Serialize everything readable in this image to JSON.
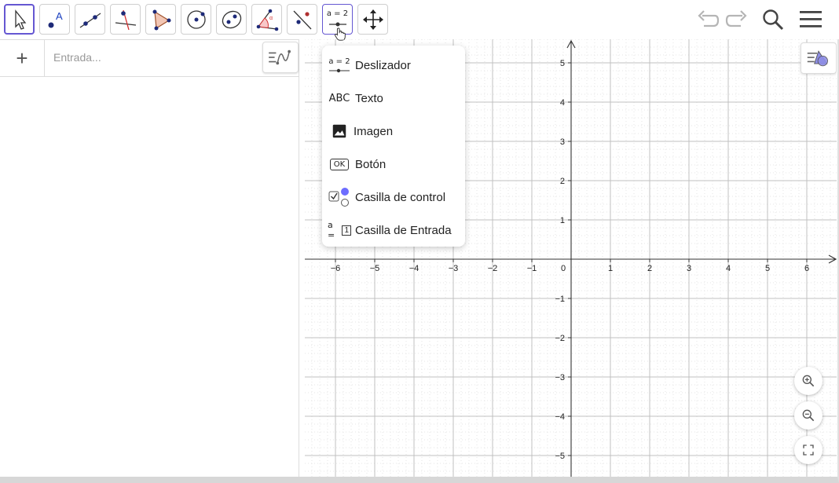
{
  "toolbar": {
    "tools": [
      {
        "name": "move-tool",
        "icon": "cursor-arrow-icon",
        "active": true
      },
      {
        "name": "point-tool",
        "icon": "point-icon"
      },
      {
        "name": "line-tool",
        "icon": "line-icon"
      },
      {
        "name": "perpendicular-line-tool",
        "icon": "perpendicular-line-icon"
      },
      {
        "name": "polygon-tool",
        "icon": "polygon-icon"
      },
      {
        "name": "circle-tool",
        "icon": "circle-icon"
      },
      {
        "name": "conic-tool",
        "icon": "ellipse-icon"
      },
      {
        "name": "angle-tool",
        "icon": "angle-icon"
      },
      {
        "name": "reflect-tool",
        "icon": "reflect-icon"
      },
      {
        "name": "slider-tool",
        "icon": "slider-icon",
        "label": "a = 2",
        "open": true
      },
      {
        "name": "move-graphics-tool",
        "icon": "move-graphics-icon"
      }
    ],
    "right": [
      "undo-icon",
      "redo-icon",
      "search-icon",
      "menu-icon"
    ]
  },
  "algebra": {
    "add_label": "+",
    "input_placeholder": "Entrada..."
  },
  "dropdown": {
    "items": [
      {
        "label": "Deslizador",
        "icon": "slider-icon",
        "icon_text": "a = 2"
      },
      {
        "label": "Texto",
        "icon": "text-icon",
        "icon_text": "ABC"
      },
      {
        "label": "Imagen",
        "icon": "image-icon"
      },
      {
        "label": "Botón",
        "icon": "button-icon",
        "icon_text": "OK"
      },
      {
        "label": "Casilla de control",
        "icon": "checkbox-icon"
      },
      {
        "label": "Casilla de Entrada",
        "icon": "input-box-icon",
        "icon_text": "a =",
        "icon_box_text": "1"
      }
    ]
  },
  "graphics": {
    "x_ticks": [
      "−6",
      "−5",
      "−4",
      "−3",
      "−2",
      "−1",
      "0",
      "1",
      "2",
      "3",
      "4",
      "5",
      "6"
    ],
    "y_ticks_pos": [
      "5",
      "4",
      "3",
      "2",
      "1"
    ],
    "y_ticks_neg": [
      "−1",
      "−2",
      "−3",
      "−4",
      "−5"
    ],
    "x_range": [
      -6.8,
      6.8
    ],
    "y_range": [
      -5.5,
      5.5
    ]
  },
  "colors": {
    "accent": "#6557d2",
    "grid_major": "#c0c0c0",
    "grid_minor": "#e6e6e6"
  }
}
